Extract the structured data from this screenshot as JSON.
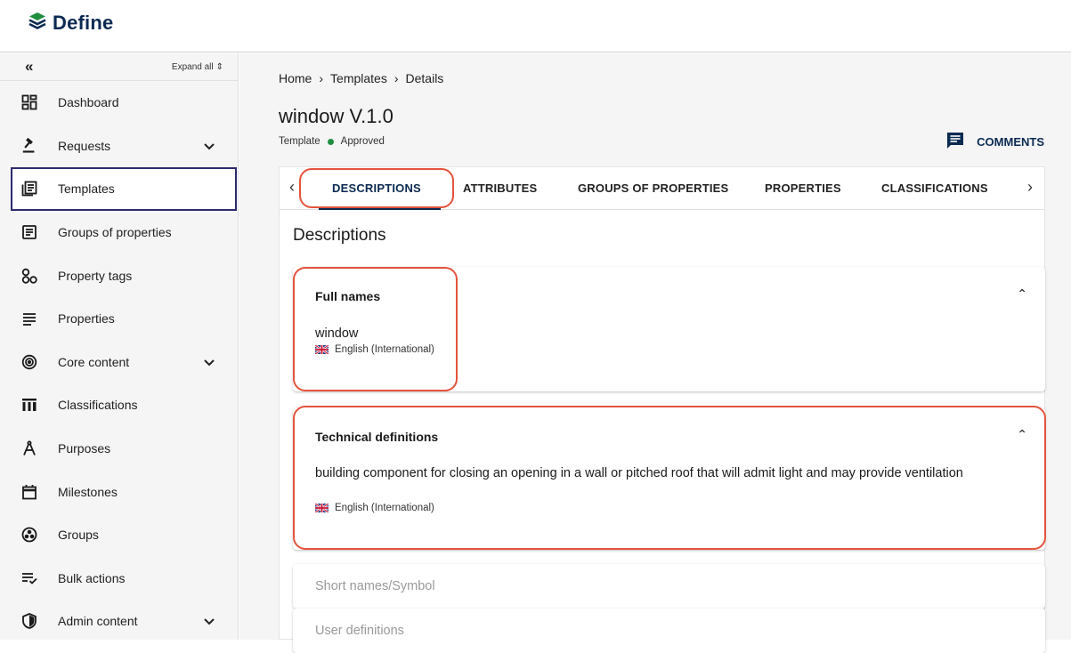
{
  "brand": {
    "name": "Define",
    "color": "#0b2a52",
    "logo_icon": "layers-logo-icon"
  },
  "sidebar": {
    "collapse_icon": "«",
    "expand_all": "Expand all",
    "items": [
      {
        "label": "Dashboard",
        "icon": "dashboard-icon"
      },
      {
        "label": "Requests",
        "icon": "gavel-icon",
        "expandable": true
      },
      {
        "label": "Templates",
        "icon": "templates-icon",
        "active": true
      },
      {
        "label": "Groups of properties",
        "icon": "list-doc-icon"
      },
      {
        "label": "Property tags",
        "icon": "tags-icon"
      },
      {
        "label": "Properties",
        "icon": "lines-icon"
      },
      {
        "label": "Core content",
        "icon": "target-icon",
        "expandable": true
      },
      {
        "label": "Classifications",
        "icon": "columns-icon"
      },
      {
        "label": "Purposes",
        "icon": "compass-icon"
      },
      {
        "label": "Milestones",
        "icon": "calendar-icon"
      },
      {
        "label": "Groups",
        "icon": "groups-icon"
      },
      {
        "label": "Bulk actions",
        "icon": "bulk-icon"
      },
      {
        "label": "Admin content",
        "icon": "shield-icon",
        "expandable": true
      }
    ]
  },
  "breadcrumb": {
    "home": "Home",
    "templates": "Templates",
    "details": "Details",
    "sep": "›"
  },
  "page": {
    "title": "window V.1.0",
    "type": "Template",
    "status": "Approved",
    "status_color": "#1e8e3e",
    "comments_label": "COMMENTS"
  },
  "tabs": {
    "items": [
      "DESCRIPTIONS",
      "ATTRIBUTES",
      "GROUPS OF PROPERTIES",
      "PROPERTIES",
      "CLASSIFICATIONS"
    ],
    "active": "DESCRIPTIONS"
  },
  "descriptions": {
    "heading": "Descriptions",
    "full_names": {
      "title": "Full names",
      "value": "window",
      "language": "English (International)"
    },
    "technical_definitions": {
      "title": "Technical definitions",
      "value": "building component for closing an opening in a wall or pitched roof that will admit light and may provide ventilation",
      "language": "English (International)"
    },
    "short_names": "Short names/Symbol",
    "user_definitions": "User definitions"
  },
  "highlight_color": "#e5533d"
}
